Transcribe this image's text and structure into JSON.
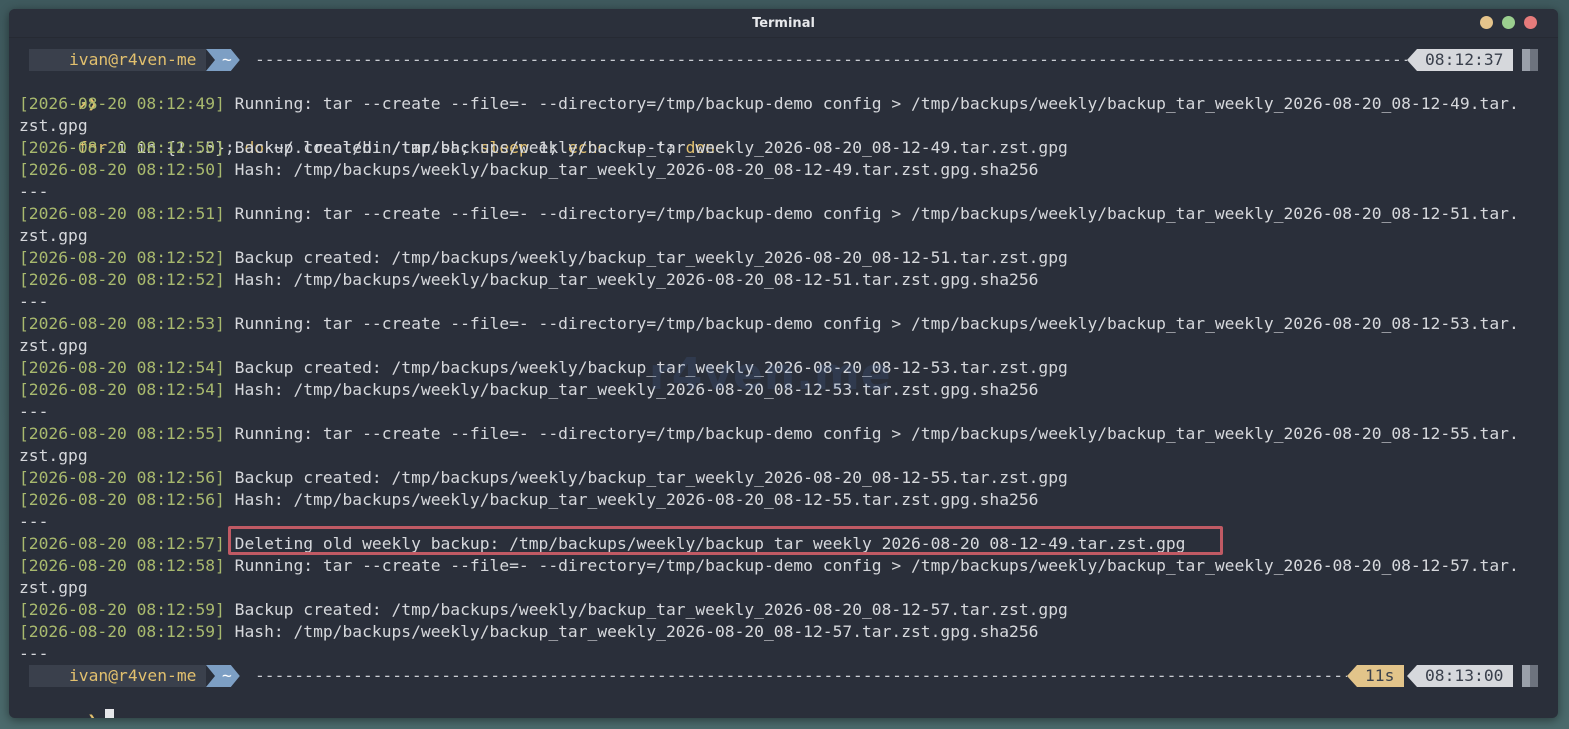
{
  "window": {
    "title": "Terminal"
  },
  "prompt_top": {
    "user": "ivan@r4ven-me",
    "dir": "~",
    "time": "08:12:37"
  },
  "command": {
    "arrow": "↗❯",
    "parts": [
      "for",
      " i in {1..5}; ",
      "do",
      " ~/.local/bin/tar.sh; ",
      "sleep",
      " 1; ",
      "echo",
      " '---'; ",
      "done"
    ]
  },
  "output": [
    {
      "ts": "[2026-08-20 08:12:49]",
      "msg": " Running: tar --create --file=- --directory=/tmp/backup-demo config > /tmp/backups/weekly/backup_tar_weekly_2026-08-20_08-12-49.tar."
    },
    {
      "ts": "",
      "msg": "zst.gpg"
    },
    {
      "ts": "[2026-08-20 08:12:50]",
      "msg": " Backup created: /tmp/backups/weekly/backup_tar_weekly_2026-08-20_08-12-49.tar.zst.gpg"
    },
    {
      "ts": "[2026-08-20 08:12:50]",
      "msg": " Hash: /tmp/backups/weekly/backup_tar_weekly_2026-08-20_08-12-49.tar.zst.gpg.sha256"
    },
    {
      "ts": "",
      "msg": "---"
    },
    {
      "ts": "[2026-08-20 08:12:51]",
      "msg": " Running: tar --create --file=- --directory=/tmp/backup-demo config > /tmp/backups/weekly/backup_tar_weekly_2026-08-20_08-12-51.tar."
    },
    {
      "ts": "",
      "msg": "zst.gpg"
    },
    {
      "ts": "[2026-08-20 08:12:52]",
      "msg": " Backup created: /tmp/backups/weekly/backup_tar_weekly_2026-08-20_08-12-51.tar.zst.gpg"
    },
    {
      "ts": "[2026-08-20 08:12:52]",
      "msg": " Hash: /tmp/backups/weekly/backup_tar_weekly_2026-08-20_08-12-51.tar.zst.gpg.sha256"
    },
    {
      "ts": "",
      "msg": "---"
    },
    {
      "ts": "[2026-08-20 08:12:53]",
      "msg": " Running: tar --create --file=- --directory=/tmp/backup-demo config > /tmp/backups/weekly/backup_tar_weekly_2026-08-20_08-12-53.tar."
    },
    {
      "ts": "",
      "msg": "zst.gpg"
    },
    {
      "ts": "[2026-08-20 08:12:54]",
      "msg": " Backup created: /tmp/backups/weekly/backup_tar_weekly_2026-08-20_08-12-53.tar.zst.gpg"
    },
    {
      "ts": "[2026-08-20 08:12:54]",
      "msg": " Hash: /tmp/backups/weekly/backup_tar_weekly_2026-08-20_08-12-53.tar.zst.gpg.sha256"
    },
    {
      "ts": "",
      "msg": "---"
    },
    {
      "ts": "[2026-08-20 08:12:55]",
      "msg": " Running: tar --create --file=- --directory=/tmp/backup-demo config > /tmp/backups/weekly/backup_tar_weekly_2026-08-20_08-12-55.tar."
    },
    {
      "ts": "",
      "msg": "zst.gpg"
    },
    {
      "ts": "[2026-08-20 08:12:56]",
      "msg": " Backup created: /tmp/backups/weekly/backup_tar_weekly_2026-08-20_08-12-55.tar.zst.gpg"
    },
    {
      "ts": "[2026-08-20 08:12:56]",
      "msg": " Hash: /tmp/backups/weekly/backup_tar_weekly_2026-08-20_08-12-55.tar.zst.gpg.sha256"
    },
    {
      "ts": "",
      "msg": "---"
    },
    {
      "ts": "[2026-08-20 08:12:57]",
      "msg": " Deleting old weekly backup: /tmp/backups/weekly/backup_tar_weekly_2026-08-20_08-12-49.tar.zst.gpg",
      "highlight": true
    },
    {
      "ts": "[2026-08-20 08:12:58]",
      "msg": " Running: tar --create --file=- --directory=/tmp/backup-demo config > /tmp/backups/weekly/backup_tar_weekly_2026-08-20_08-12-57.tar."
    },
    {
      "ts": "",
      "msg": "zst.gpg"
    },
    {
      "ts": "[2026-08-20 08:12:59]",
      "msg": " Backup created: /tmp/backups/weekly/backup_tar_weekly_2026-08-20_08-12-57.tar.zst.gpg"
    },
    {
      "ts": "[2026-08-20 08:12:59]",
      "msg": " Hash: /tmp/backups/weekly/backup_tar_weekly_2026-08-20_08-12-57.tar.zst.gpg.sha256"
    },
    {
      "ts": "",
      "msg": "---"
    }
  ],
  "prompt_bottom": {
    "user": "ivan@r4ven-me",
    "dir": "~",
    "duration": "11s",
    "time": "08:13:00"
  },
  "input": {
    "arrow": "↗❯"
  },
  "watermark": "r4ven.me",
  "colors": {
    "background": "#2a2f3a",
    "timestamp": "#a8b96e",
    "keyword": "#e2c06e",
    "highlight_border": "#c05a64",
    "dir_segment": "#7d9fc4"
  }
}
